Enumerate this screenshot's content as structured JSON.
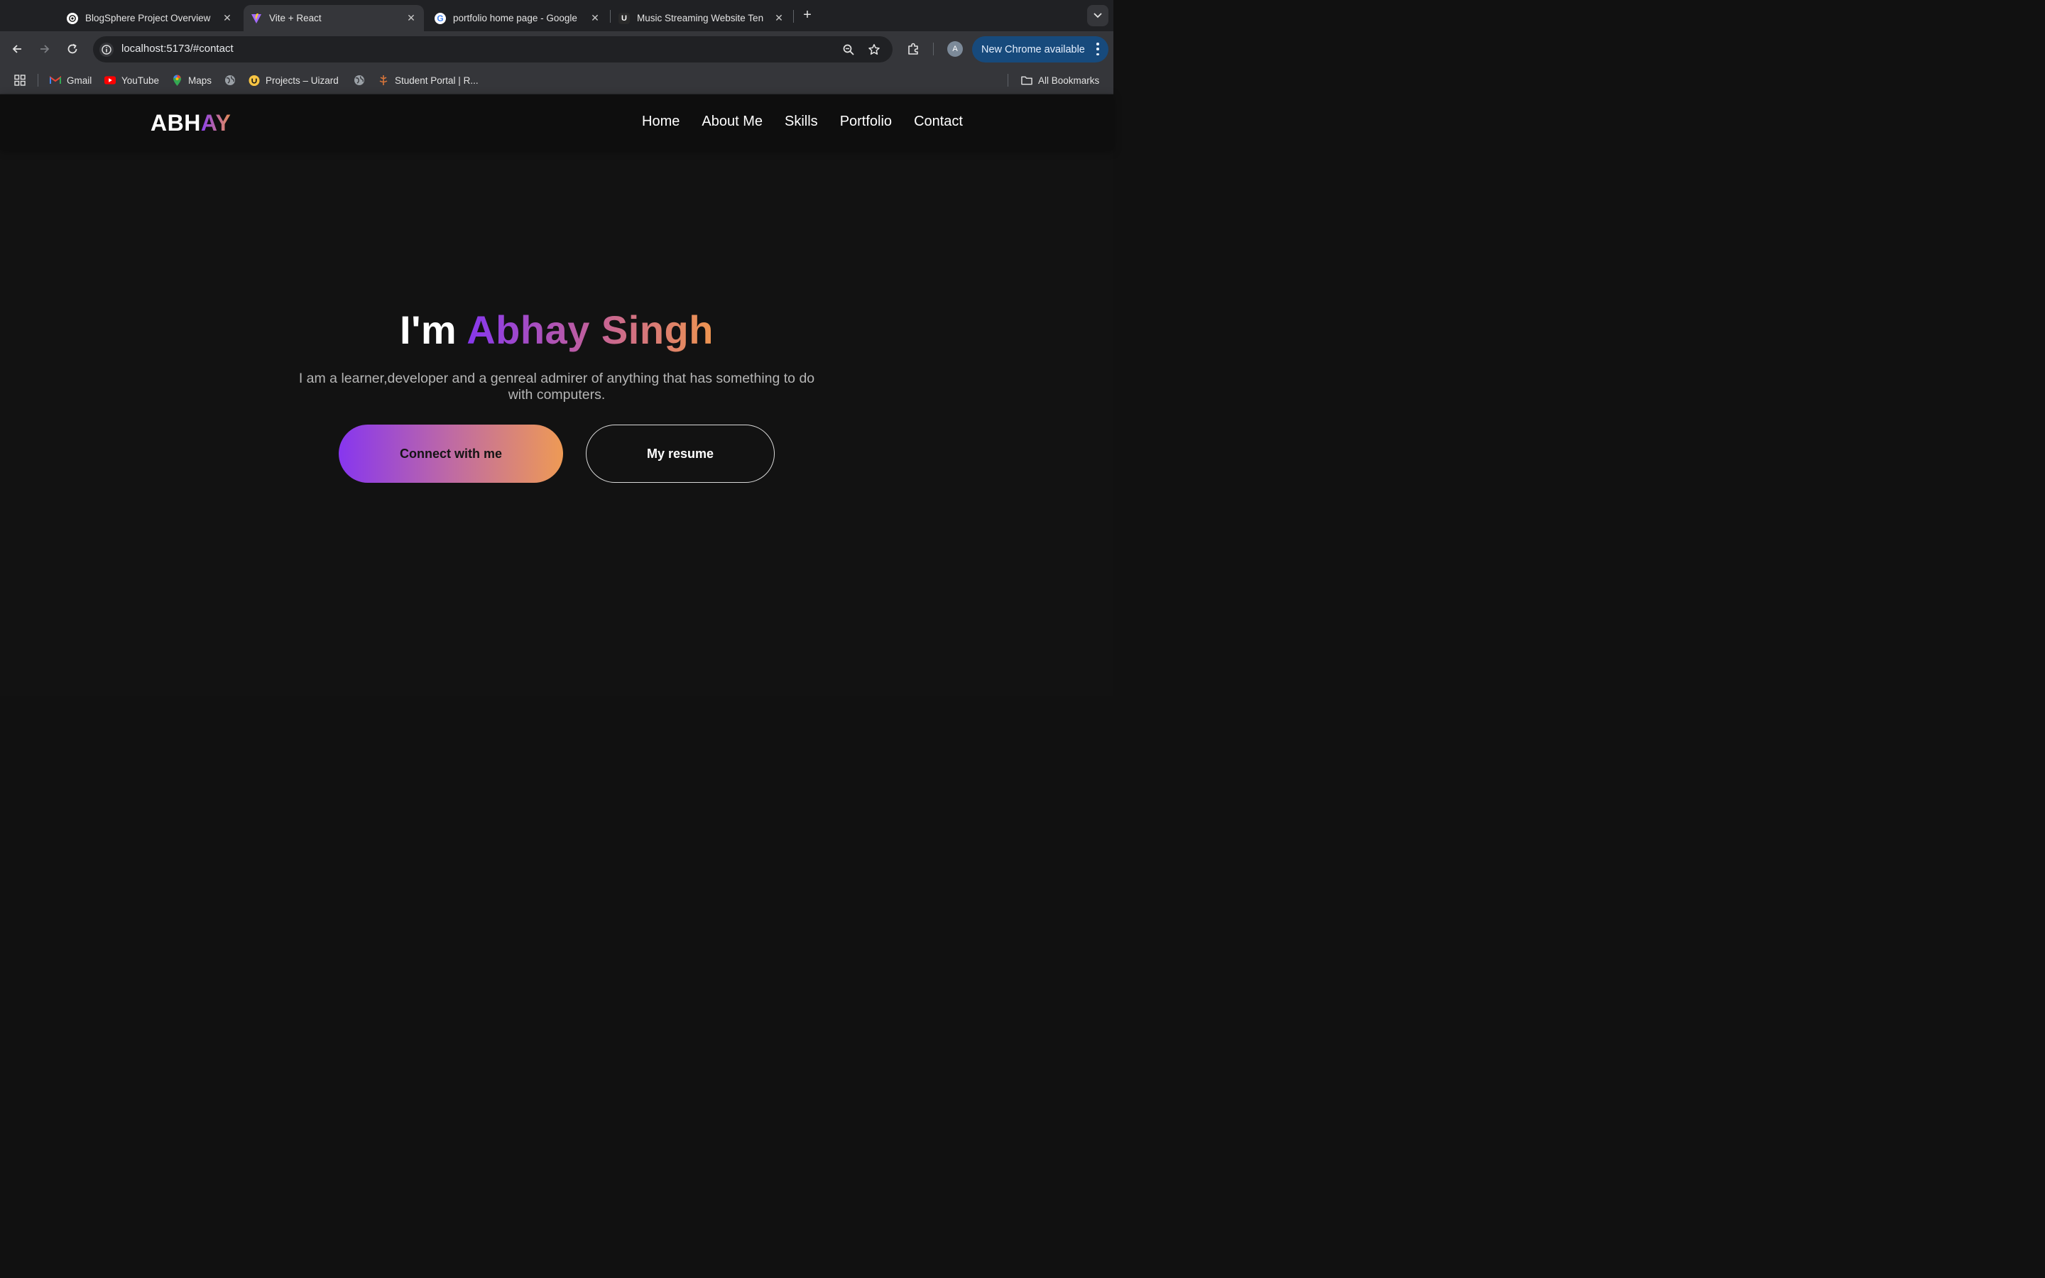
{
  "browser": {
    "tabs": [
      {
        "title": "BlogSphere Project Overview",
        "icon": "chatgpt-icon"
      },
      {
        "title": "Vite + React",
        "icon": "vite-icon",
        "active": true
      },
      {
        "title": "portfolio home page - Google",
        "icon": "google-icon"
      },
      {
        "title": "Music Streaming Website Ten",
        "icon": "uizard-icon"
      }
    ],
    "url": "localhost:5173/#contact",
    "avatar_letter": "A",
    "update_label": "New Chrome available",
    "bookmarks": [
      {
        "label": "Gmail",
        "icon": "gmail-icon"
      },
      {
        "label": "YouTube",
        "icon": "youtube-icon"
      },
      {
        "label": "Maps",
        "icon": "maps-icon"
      },
      {
        "label": "",
        "icon": "globe-icon"
      },
      {
        "label": "Projects – Uizard",
        "icon": "uizard-icon"
      },
      {
        "label": "",
        "icon": "globe-icon"
      },
      {
        "label": "Student Portal | R...",
        "icon": "student-portal-icon"
      }
    ],
    "all_bookmarks_label": "All Bookmarks"
  },
  "site": {
    "logo_plain": "ABH",
    "logo_accent": "AY",
    "nav": [
      "Home",
      "About Me",
      "Skills",
      "Portfolio",
      "Contact"
    ],
    "hero": {
      "greeting": "I'm ",
      "name": "Abhay Singh",
      "subtitle": "I am a learner,developer and a genreal admirer of anything that has something to do with computers.",
      "primary_button": "Connect with me",
      "secondary_button": "My resume"
    }
  },
  "colors": {
    "accent_start": "#8736ef",
    "accent_end": "#ee9a55",
    "page_bg": "#121212",
    "chrome_update_bg": "#174a7c"
  }
}
